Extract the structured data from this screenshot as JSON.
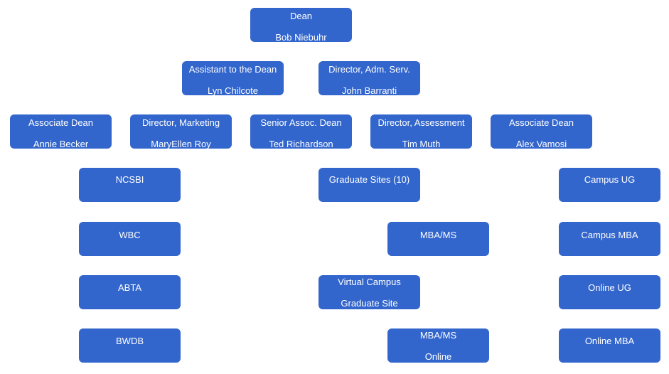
{
  "chart": {
    "title": "",
    "box_color": "#3366cc",
    "text_color": "#ffffff"
  },
  "nodes": [
    {
      "line1": "Dean",
      "line2": "Bob Niebuhr"
    },
    {
      "line1": "Assistant to the Dean",
      "line2": "Lyn Chilcote"
    },
    {
      "line1": "Director, Adm. Serv.",
      "line2": "John Barranti"
    },
    {
      "line1": "Associate Dean",
      "line2": "Annie Becker"
    },
    {
      "line1": "Director, Marketing",
      "line2": "MaryEllen Roy"
    },
    {
      "line1": "Senior Assoc. Dean",
      "line2": "Ted Richardson"
    },
    {
      "line1": "Director, Assessment",
      "line2": "Tim Muth"
    },
    {
      "line1": "Associate Dean",
      "line2": "Alex Vamosi"
    },
    {
      "line1": "NCSBI",
      "line2": ""
    },
    {
      "line1": "WBC",
      "line2": ""
    },
    {
      "line1": "ABTA",
      "line2": ""
    },
    {
      "line1": "BWDB",
      "line2": ""
    },
    {
      "line1": "Graduate Sites (10)",
      "line2": ""
    },
    {
      "line1": "MBA/MS",
      "line2": ""
    },
    {
      "line1": "Virtual Campus",
      "line2": "Graduate Site"
    },
    {
      "line1": "MBA/MS",
      "line2": "Online"
    },
    {
      "line1": "Campus UG",
      "line2": ""
    },
    {
      "line1": "Campus MBA",
      "line2": ""
    },
    {
      "line1": "Online UG",
      "line2": ""
    },
    {
      "line1": "Online MBA",
      "line2": ""
    }
  ]
}
